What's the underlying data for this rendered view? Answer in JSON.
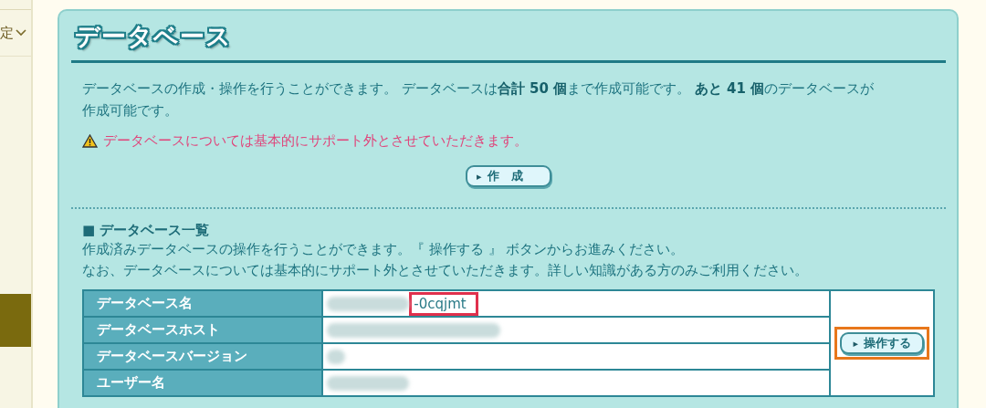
{
  "sidebar": {
    "items": [
      {
        "label": "定"
      }
    ]
  },
  "panel": {
    "title": "データベース",
    "intro": "データベースの作成・操作を行うことができます。 データベースは**合計 50 個**まで作成可能です。 **あと 41 個**のデータベースが作成可能です。",
    "warning": "データベースについては基本的にサポート外とさせていただきます。",
    "create_button": {
      "icon": "▸",
      "label": "作　成"
    }
  },
  "list": {
    "heading_mark": "■",
    "heading": "データベース一覧",
    "notes": [
      "作成済みデータベースの操作を行うことができます。『 操作する 』 ボタンからお進みください。",
      "なお、データベースについては基本的にサポート外とさせていただきます。詳しい知識がある方のみご利用ください。"
    ],
    "rows": [
      {
        "label": "データベース名",
        "value": "-0cqjmt",
        "redacted": true,
        "highlighted": true
      },
      {
        "label": "データベースホスト",
        "redacted": true
      },
      {
        "label": "データベースバージョン",
        "redacted": true
      },
      {
        "label": "ユーザー名",
        "redacted": true
      }
    ],
    "operate_button": {
      "icon": "▸",
      "label": "操作する",
      "highlighted": true
    }
  }
}
